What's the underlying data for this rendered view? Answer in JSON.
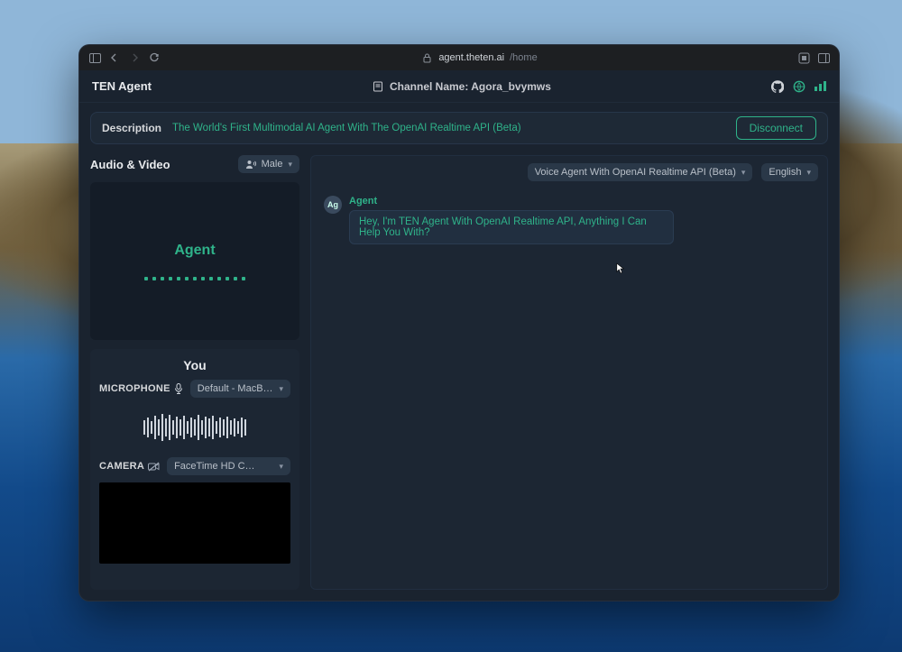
{
  "browser": {
    "url_host": "agent.theten.ai",
    "url_path": "/home"
  },
  "header": {
    "brand": "TEN Agent",
    "channel_label": "Channel Name: Agora_bvymws"
  },
  "description_bar": {
    "label": "Description",
    "text": "The World's First Multimodal AI Agent With The OpenAI Realtime API (Beta)",
    "disconnect_button": "Disconnect"
  },
  "left": {
    "section_title": "Audio & Video",
    "voice_selector": "Male",
    "agent_label": "Agent",
    "you_label": "You",
    "microphone_label": "MICROPHONE",
    "microphone_device": "Default - MacBook Pr...",
    "camera_label": "CAMERA",
    "camera_device": "FaceTime HD Camer..."
  },
  "right": {
    "agent_type_selector": "Voice Agent With OpenAI Realtime API (Beta)",
    "language_selector": "English"
  },
  "chat": {
    "agent_name": "Agent",
    "agent_avatar": "Ag",
    "agent_message": "Hey, I'm TEN Agent With OpenAI Realtime API, Anything I Can Help You With?"
  }
}
